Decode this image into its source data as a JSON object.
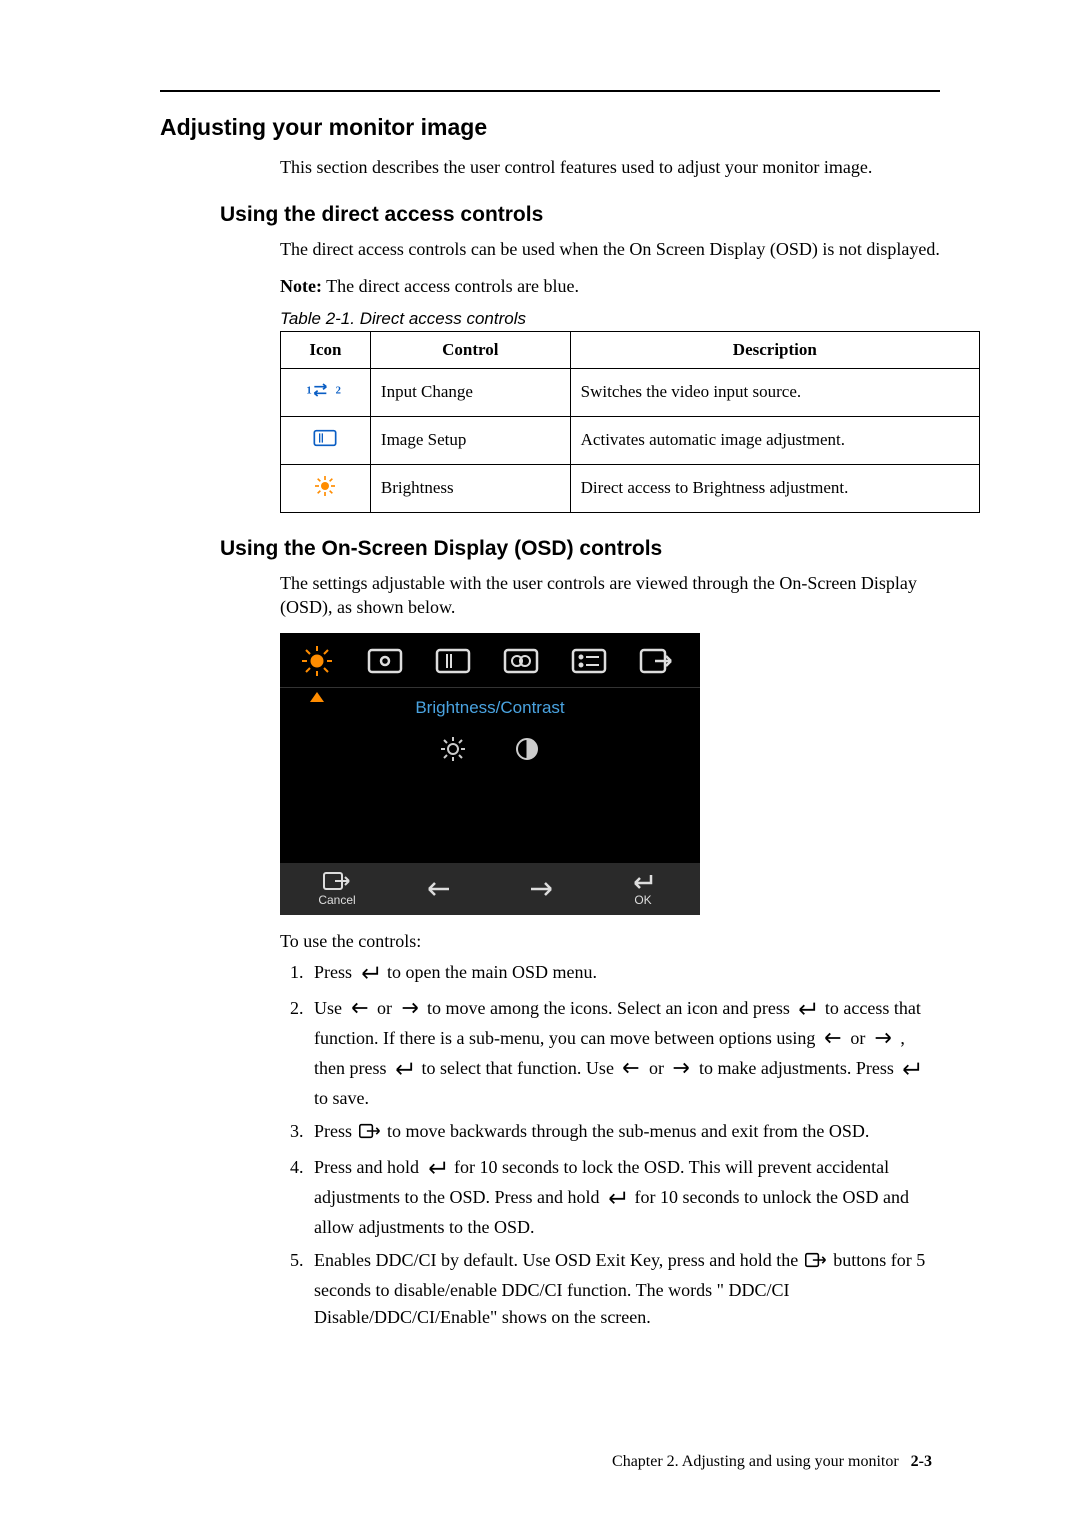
{
  "header": {
    "title": "Adjusting your monitor image"
  },
  "intro": "This section describes the user control features used to adjust your monitor image.",
  "sub1": {
    "title": "Using the direct access controls",
    "p1": "The direct access controls can be used when the On Screen Display (OSD) is not displayed.",
    "note_label": "Note:",
    "note_text": " The direct access controls are blue.",
    "table_caption": "Table 2-1. Direct access controls",
    "headers": {
      "icon": "Icon",
      "control": "Control",
      "desc": "Description"
    },
    "rows": [
      {
        "control": "Input Change",
        "desc": "Switches the video input source."
      },
      {
        "control": "Image Setup",
        "desc": "Activates automatic image adjustment."
      },
      {
        "control": "Brightness",
        "desc": "Direct access to Brightness adjustment."
      }
    ]
  },
  "sub2": {
    "title": "Using the On-Screen Display (OSD) controls",
    "p1": "The settings adjustable with the user controls are viewed through the On-Screen Display (OSD), as shown below.",
    "osd": {
      "sub_label": "Brightness/Contrast",
      "cancel": "Cancel",
      "ok": "OK"
    },
    "pre_list": "To use the controls:",
    "steps": {
      "s1": {
        "a": "Press ",
        "b": " to open the main OSD menu."
      },
      "s2": {
        "a": "Use ",
        "b": " or ",
        "c": " to move among the icons. Select an icon and press ",
        "d": " to access that function. If there is a sub-menu, you can move between options using ",
        "e": " or ",
        "f": " , then press ",
        "g": " to select that function. Use ",
        "h": " or ",
        "i": " to make adjustments. Press ",
        "j": " to save."
      },
      "s3": {
        "a": "Press ",
        "b": " to move backwards through the sub-menus and exit from the OSD."
      },
      "s4": {
        "a": "Press and hold ",
        "b": " for 10 seconds to lock the OSD. This will prevent accidental adjustments to the OSD. Press and hold ",
        "c": " for 10 seconds to unlock the OSD and allow adjustments to the OSD."
      },
      "s5": "Enables DDC/CI by default. Use OSD Exit Key, press and hold the",
      "s5b": " buttons for 5 seconds to disable/enable DDC/CI function. The words \" DDC/CI Disable/DDC/CI/Enable\" shows on the screen."
    }
  },
  "footer": {
    "chapter": "Chapter 2. Adjusting and using your monitor",
    "page": "2-3"
  }
}
